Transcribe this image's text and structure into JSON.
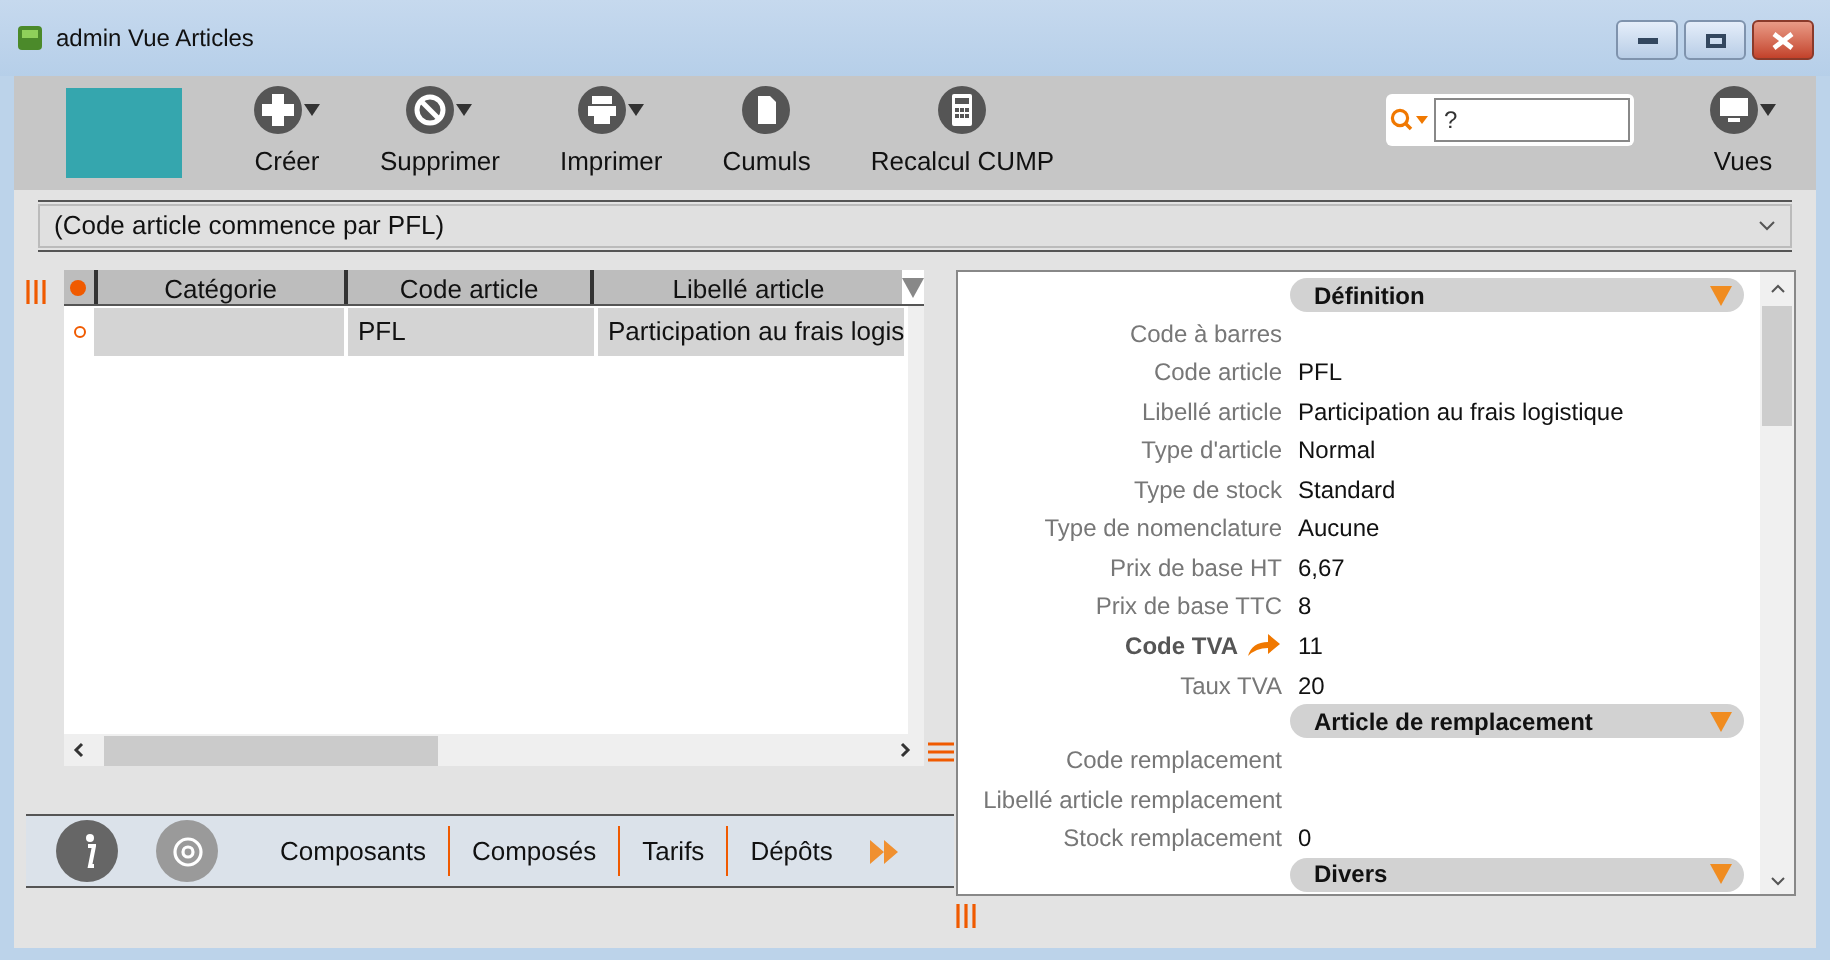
{
  "window": {
    "title": "admin Vue Articles"
  },
  "toolbar": {
    "buttons": [
      {
        "label": "Créer",
        "kind": "plus",
        "menu": true
      },
      {
        "label": "Supprimer",
        "kind": "ban",
        "menu": true
      },
      {
        "label": "Imprimer",
        "kind": "printer",
        "menu": true
      },
      {
        "label": "Cumuls",
        "kind": "document",
        "menu": false
      },
      {
        "label": "Recalcul CUMP",
        "kind": "calculator",
        "menu": false
      }
    ],
    "search": {
      "value": "?"
    },
    "views": {
      "label": "Vues"
    }
  },
  "filter": {
    "value": "(Code article commence par PFL)"
  },
  "grid": {
    "columns": [
      "Catégorie",
      "Code article",
      "Libellé article"
    ],
    "rows": [
      {
        "cells": [
          "",
          "PFL",
          "Participation au frais logis"
        ]
      }
    ]
  },
  "bottom_tabs": [
    "Composants",
    "Composés",
    "Tarifs",
    "Dépôts"
  ],
  "detail": [
    {
      "kind": "header",
      "label": "Définition"
    },
    {
      "kind": "field",
      "label": "Code à barres"
    },
    {
      "kind": "field",
      "label": "Code article",
      "value": "PFL"
    },
    {
      "kind": "field",
      "label": "Libellé article",
      "value": "Participation au frais logistique"
    },
    {
      "kind": "field",
      "label": "Type d'article",
      "value": "Normal"
    },
    {
      "kind": "field",
      "label": "Type de stock",
      "value": "Standard"
    },
    {
      "kind": "field",
      "label": "Type de nomenclature",
      "value": "Aucune"
    },
    {
      "kind": "field",
      "label": "Prix de base HT",
      "value": "6,67"
    },
    {
      "kind": "field",
      "label": "Prix de base TTC",
      "value": "8"
    },
    {
      "kind": "link",
      "label": "Code TVA",
      "value": "11"
    },
    {
      "kind": "field",
      "label": "Taux TVA",
      "value": "20"
    },
    {
      "kind": "header",
      "label": "Article de remplacement"
    },
    {
      "kind": "field",
      "label": "Code remplacement"
    },
    {
      "kind": "field",
      "label": "Libellé article remplacement"
    },
    {
      "kind": "field",
      "label": "Stock remplacement",
      "value": "0"
    },
    {
      "kind": "header",
      "label": "Divers"
    }
  ]
}
